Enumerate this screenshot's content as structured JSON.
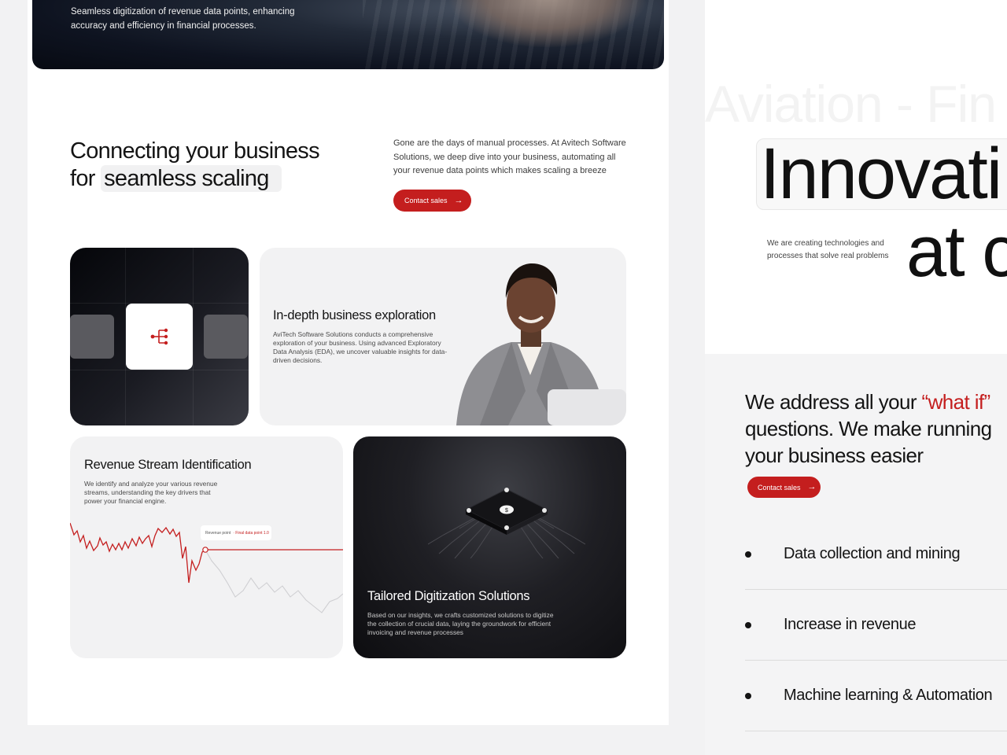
{
  "hero": {
    "description": "Seamless digitization of revenue data points, enhancing accuracy and efficiency in financial processes."
  },
  "intro": {
    "headline_line1": "Connecting your business",
    "headline_for": "for",
    "headline_highlight": "seamless scaling",
    "paragraph": "Gone are the days of manual processes. At Avitech Software Solutions, we deep dive into your business, automating all your revenue data points which makes scaling a breeze",
    "contact_label": "Contact sales",
    "contact_icon": "arrow-right-icon"
  },
  "features": {
    "exploration": {
      "title": "In-depth business exploration",
      "description": "AviTech Software Solutions conducts a comprehensive exploration of your business. Using advanced Exploratory Data Analysis (EDA), we uncover valuable insights for data-driven decisions."
    },
    "revenue": {
      "title": "Revenue Stream Identification",
      "description": "We identify and analyze your various revenue streams, understanding the key drivers that power your financial engine.",
      "point_label": "Revenue point",
      "point_value": "· Final data point 1.0"
    },
    "digitization": {
      "title": "Tailored Digitization Solutions",
      "description": "Based on our insights, we crafts customized solutions to digitize the collection of crucial data, laying the groundwork for efficient invoicing and revenue processes",
      "chip_icon": "dollar-chip-icon"
    }
  },
  "innovation": {
    "background_text": "Aviation - Fin",
    "big_word_1": "Innovati",
    "big_word_2": "at c",
    "tagline": "We are creating technologies and processes that solve real problems"
  },
  "address": {
    "line1_prefix": "We address all your ",
    "line1_highlight": "“what if”",
    "line2": "questions. We make running",
    "line3": "your business easier",
    "contact_label": "Contact sales",
    "items": [
      {
        "label": "Data collection and mining"
      },
      {
        "label": "Increase in revenue"
      },
      {
        "label": "Machine learning & Automation"
      }
    ]
  },
  "colors": {
    "accent": "#c41e1e",
    "text": "#141414",
    "card_light": "#f2f2f3",
    "card_dark": "#1a1b22"
  }
}
